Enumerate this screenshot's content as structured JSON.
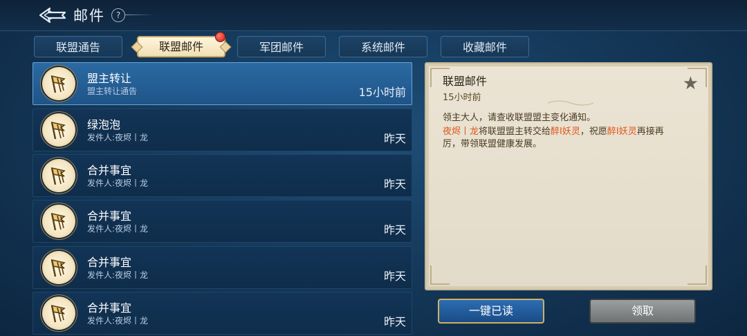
{
  "header": {
    "title": "邮件",
    "help": "?"
  },
  "tabs": [
    {
      "label": "联盟通告"
    },
    {
      "label": "联盟邮件"
    },
    {
      "label": "军团邮件"
    },
    {
      "label": "系统邮件"
    },
    {
      "label": "收藏邮件"
    }
  ],
  "mails": [
    {
      "subject": "盟主转让",
      "sub": "盟主转让通告",
      "time": "15小时前"
    },
    {
      "subject": "绿泡泡",
      "sub": "发件人:夜烬丨龙",
      "time": "昨天"
    },
    {
      "subject": "合并事宜",
      "sub": "发件人:夜烬丨龙",
      "time": "昨天"
    },
    {
      "subject": "合并事宜",
      "sub": "发件人:夜烬丨龙",
      "time": "昨天"
    },
    {
      "subject": "合并事宜",
      "sub": "发件人:夜烬丨龙",
      "time": "昨天"
    },
    {
      "subject": "合并事宜",
      "sub": "发件人:夜烬丨龙",
      "time": "昨天"
    }
  ],
  "detail": {
    "title": "联盟邮件",
    "time": "15小时前",
    "line1": "领主大人，请查收联盟盟主变化通知。",
    "name_from": "夜烬丨龙",
    "text_a": "将联盟盟主转交给",
    "name_to": "醉I妖灵",
    "text_b": "，祝愿",
    "name_to2": "醉I妖灵",
    "text_c": "再接再",
    "line3": "厉，带领联盟健康发展。"
  },
  "buttons": {
    "read_all": "一键已读",
    "claim": "领取"
  },
  "colors": {
    "highlight": "#e0551b",
    "accent_gold": "#d4b062"
  }
}
